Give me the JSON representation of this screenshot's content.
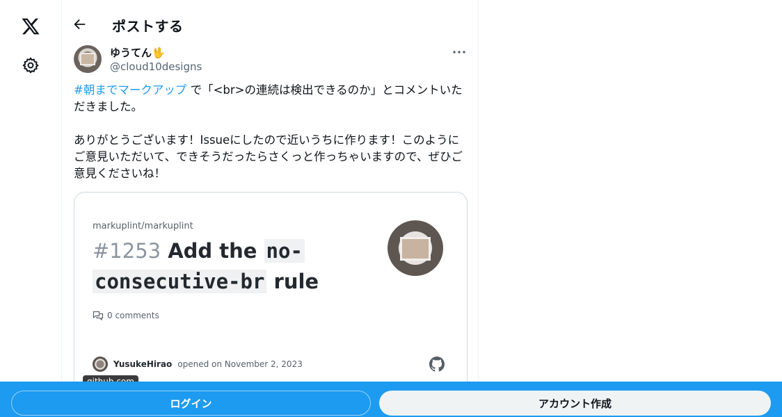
{
  "nav": {
    "logo_icon": "x-logo-icon",
    "settings_icon": "gear-icon"
  },
  "header": {
    "title": "ポストする",
    "back_icon": "arrow-left-icon"
  },
  "post": {
    "display_name": "ゆうてん🖖",
    "handle": "@cloud10designs",
    "hashtag": "#朝までマークアップ",
    "text_after_hashtag": " で「<br>の連続は検出できるのか」とコメントいただきました。\n\nありがとうございます！Issueにしたので近いうちに作ります！このようにご意見いただいて、できそうだったらさくっと作っちゃいますので、ぜひご意見くださいね！",
    "more_icon": "more-horizontal-icon"
  },
  "card": {
    "repo": "markuplint/markuplint",
    "issue_number": "#1253",
    "title_prefix": " Add the ",
    "title_code_a": "no-",
    "title_code_b": "consecutive-br",
    "title_suffix": " rule",
    "comments": "0 comments",
    "author": "YusukeHirao",
    "opened_text": "opened on November 2, 2023",
    "domain": "github.com",
    "github_icon": "github-icon",
    "comment_icon": "comment-icon"
  },
  "bottom_bar": {
    "login_label": "ログイン",
    "signup_label": "アカウント作成",
    "color": "#1d9bf0"
  }
}
